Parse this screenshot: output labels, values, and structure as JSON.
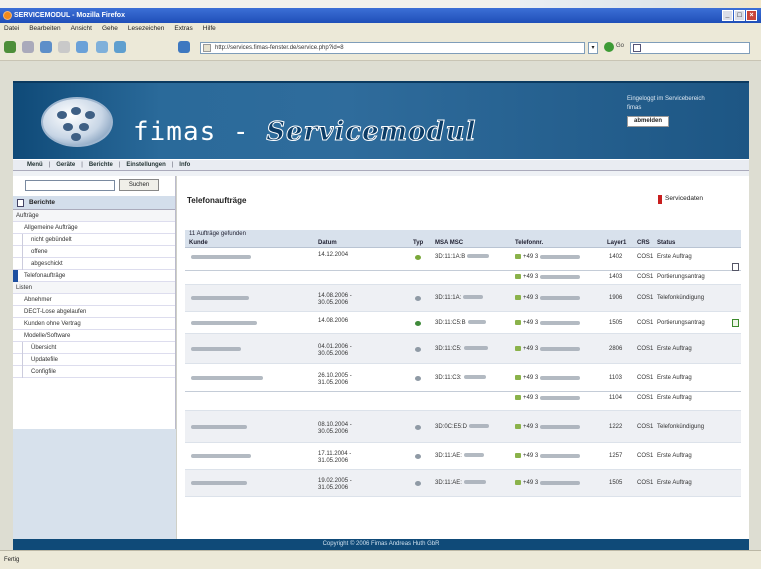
{
  "window": {
    "title": "SERVICEMODUL - Mozilla Firefox",
    "controls": [
      "_",
      "□",
      "×"
    ]
  },
  "menubar": [
    "Datei",
    "Bearbeiten",
    "Ansicht",
    "Gehe",
    "Lesezeichen",
    "Extras",
    "Hilfe"
  ],
  "toolbar": {
    "url": "http://services.fimas-fenster.de/service.php?id=8",
    "go_label": "Go"
  },
  "banner": {
    "brand_prefix": "fimas - ",
    "brand_suffix": "Servicemodul",
    "login_line1": "Eingeloggt im Servicebereich",
    "login_line2": "fimas",
    "logout_label": "abmelden"
  },
  "nav": [
    "Menü",
    "Geräte",
    "Berichte",
    "Einstellungen",
    "Info"
  ],
  "sidebar": {
    "search_button": "Suchen",
    "section_title": "Berichte",
    "items": [
      {
        "label": "Aufträge",
        "level": 0
      },
      {
        "label": "Allgemeine Aufträge",
        "level": 1
      },
      {
        "label": "nicht gebündelt",
        "level": 2
      },
      {
        "label": "offene",
        "level": 2
      },
      {
        "label": "abgeschickt",
        "level": 2
      },
      {
        "label": "Telefonaufträge",
        "level": 1,
        "active": true
      },
      {
        "label": "Listen",
        "level": 0
      },
      {
        "label": "Abnehmer",
        "level": 1
      },
      {
        "label": "DECT-Lose abgelaufen",
        "level": 1
      },
      {
        "label": "Kunden ohne Vertrag",
        "level": 1
      },
      {
        "label": "Modelle/Software",
        "level": 1
      },
      {
        "label": "Übersicht",
        "level": 2
      },
      {
        "label": "Updatefile",
        "level": 2
      },
      {
        "label": "Configfile",
        "level": 2
      }
    ]
  },
  "main": {
    "title": "Telefonaufträge",
    "service_link": "Servicedaten",
    "found_text": "11 Aufträge gefunden",
    "columns": [
      "Kunde",
      "Datum",
      "Typ",
      "MSA MSC",
      "Telefonnr.",
      "Layer1",
      "CRS",
      "Status"
    ],
    "rows": [
      {
        "date": "14.12.2004",
        "typ_color": "#7aa83a",
        "msa": "3D:11:1A:B",
        "lines": [
          {
            "phone": "+49 3",
            "layer": "1402",
            "crs": "COS1",
            "status": "Erste Auftrag"
          },
          {
            "phone": "+49 3",
            "layer": "1403",
            "crs": "COS1",
            "status": "Portierungsantrag"
          }
        ],
        "doc": "plain"
      },
      {
        "date": "14.08.2006 - 30.05.2006",
        "typ_color": "#8f9aa5",
        "msa": "3D:11:1A:",
        "lines": [
          {
            "phone": "+49 3",
            "layer": "1906",
            "crs": "COS1",
            "status": "Telefonkündigung"
          }
        ]
      },
      {
        "date": "14.08.2006",
        "typ_color": "#3f8a3a",
        "msa": "3D:11:C5:B",
        "lines": [
          {
            "phone": "+49 3",
            "layer": "1505",
            "crs": "COS1",
            "status": "Portierungsantrag"
          }
        ],
        "doc": "green"
      },
      {
        "date": "04.01.2006 - 30.05.2006",
        "typ_color": "#8f9aa5",
        "msa": "3D:11:C5:",
        "lines": [
          {
            "phone": "+49 3",
            "layer": "2806",
            "crs": "COS1",
            "status": "Erste Auftrag"
          }
        ]
      },
      {
        "date": "26.10.2005 - 31.05.2006",
        "typ_color": "#8f9aa5",
        "msa": "3D:11:C3:",
        "lines": [
          {
            "phone": "+49 3",
            "layer": "1103",
            "crs": "COS1",
            "status": "Erste Auftrag"
          },
          {
            "phone": "+49 3",
            "layer": "1104",
            "crs": "COS1",
            "status": "Erste Auftrag"
          }
        ]
      },
      {
        "date": "08.10.2004 - 30.05.2006",
        "typ_color": "#8f9aa5",
        "msa": "3D:0C:E5:D",
        "lines": [
          {
            "phone": "+49 3",
            "layer": "1222",
            "crs": "COS1",
            "status": "Telefonkündigung"
          }
        ]
      },
      {
        "date": "17.11.2004 - 31.05.2006",
        "typ_color": "#8f9aa5",
        "msa": "3D:11:AE:",
        "lines": [
          {
            "phone": "+49 3",
            "layer": "1257",
            "crs": "COS1",
            "status": "Erste Auftrag"
          }
        ]
      },
      {
        "date": "19.02.2005 - 31.05.2006",
        "typ_color": "#8f9aa5",
        "msa": "3D:11:AE:",
        "lines": [
          {
            "phone": "+49 3",
            "layer": "1505",
            "crs": "COS1",
            "status": "Erste Auftrag"
          }
        ]
      }
    ]
  },
  "footer": "Copyright © 2006 Fimas Andreas Huth GbR",
  "statusbar": "Fertig",
  "colors": {
    "banner": "#2f6c9c",
    "nav_bg": "#e9ecf2",
    "footer": "#0f4a78",
    "active": "#1d4fa0"
  }
}
